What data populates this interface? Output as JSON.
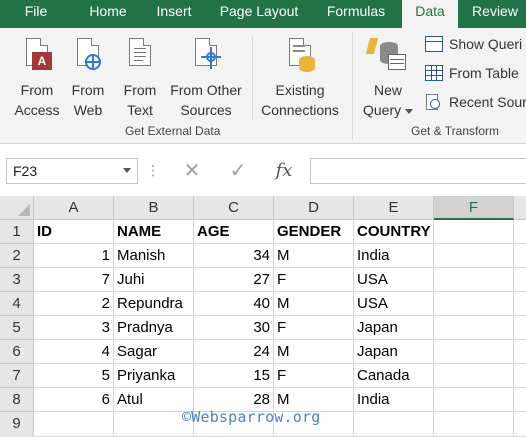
{
  "tabs": [
    {
      "label": "File",
      "active": false
    },
    {
      "label": "Home",
      "active": false
    },
    {
      "label": "Insert",
      "active": false
    },
    {
      "label": "Page Layout",
      "active": false
    },
    {
      "label": "Formulas",
      "active": false
    },
    {
      "label": "Data",
      "active": true
    },
    {
      "label": "Review",
      "active": false
    }
  ],
  "ribbon": {
    "get_external_data": {
      "group_label": "Get External Data",
      "from_access": {
        "line1": "From",
        "line2": "Access"
      },
      "from_web": {
        "line1": "From",
        "line2": "Web"
      },
      "from_text": {
        "line1": "From",
        "line2": "Text"
      },
      "from_other": {
        "line1": "From Other",
        "line2": "Sources"
      },
      "existing": {
        "line1": "Existing",
        "line2": "Connections"
      }
    },
    "get_transform": {
      "group_label": "Get & Transform",
      "new_query": {
        "line1": "New",
        "line2": "Query"
      },
      "show_queries": "Show Queri",
      "from_table": "From Table",
      "recent_sources": "Recent Sour"
    }
  },
  "formula_bar": {
    "name_box": "F23",
    "cancel_glyph": "✕",
    "enter_glyph": "✓",
    "fx_glyph": "fx",
    "dots": "⋮",
    "value": ""
  },
  "columns": [
    "A",
    "B",
    "C",
    "D",
    "E",
    "F"
  ],
  "selected_column": "F",
  "rows": [
    "1",
    "2",
    "3",
    "4",
    "5",
    "6",
    "7",
    "8",
    "9"
  ],
  "table": {
    "header": [
      "ID",
      "NAME",
      "AGE",
      "GENDER",
      "COUNTRY"
    ],
    "data": [
      [
        "1",
        "Manish",
        "34",
        "M",
        "India"
      ],
      [
        "7",
        "Juhi",
        "27",
        "F",
        "USA"
      ],
      [
        "2",
        "Repundra",
        "40",
        "M",
        "USA"
      ],
      [
        "3",
        "Pradnya",
        "30",
        "F",
        "Japan"
      ],
      [
        "4",
        "Sagar",
        "24",
        "M",
        "Japan"
      ],
      [
        "5",
        "Priyanka",
        "15",
        "F",
        "Canada"
      ],
      [
        "6",
        "Atul",
        "28",
        "M",
        "India"
      ]
    ]
  },
  "watermark": "©Websparrow.org",
  "colors": {
    "accent": "#217346",
    "watermark": "#4b83c4",
    "access_red": "#a4373a",
    "web_blue": "#2b7cd3",
    "db_gold": "#e8b43a"
  }
}
